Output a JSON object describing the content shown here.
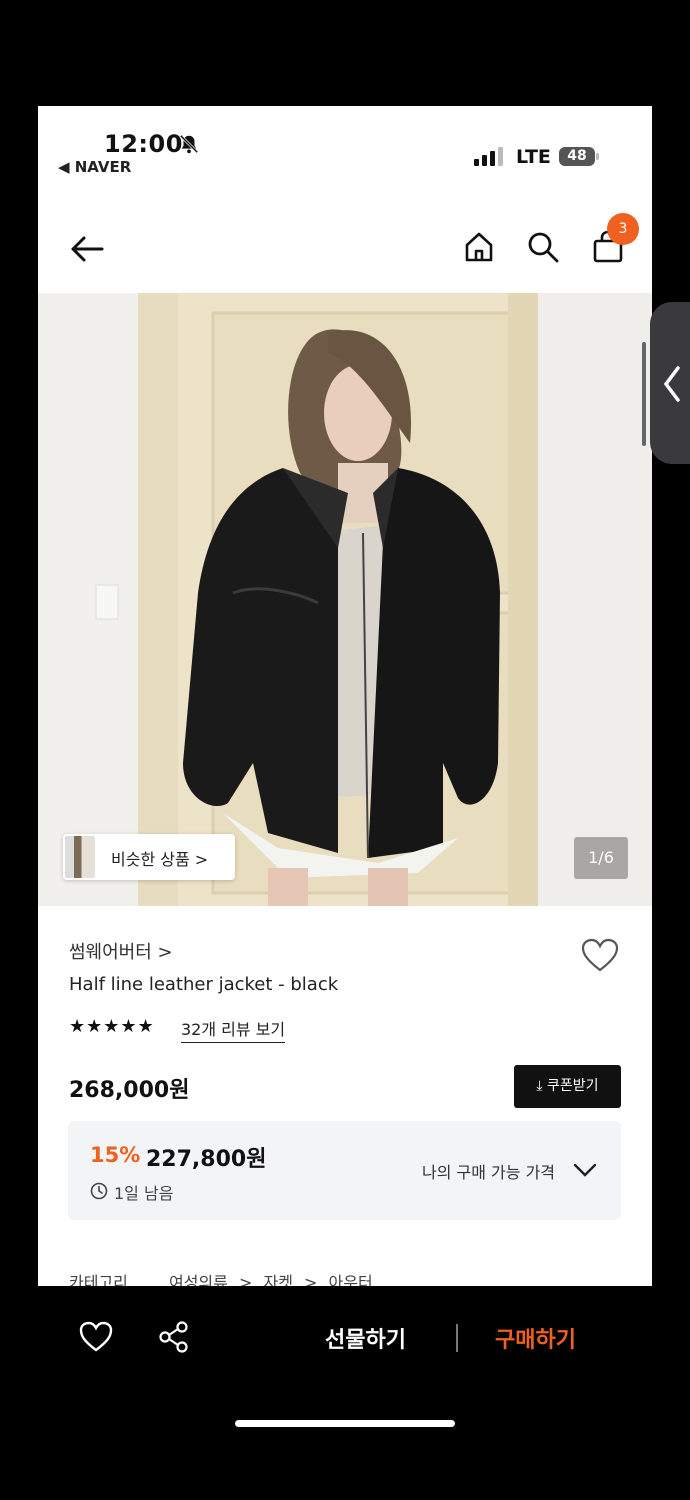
{
  "status": {
    "time": "12:00",
    "back_app": "◀ NAVER",
    "network": "LTE",
    "battery": "48"
  },
  "header": {
    "cart_count": "3"
  },
  "image": {
    "similar_label": "비슷한 상품 >",
    "counter": "1/6"
  },
  "product": {
    "brand": "썸웨어버터 >",
    "name": "Half line leather jacket - black",
    "stars": "★★★★★",
    "reviews_link": "32개 리뷰 보기",
    "price": "268,000원",
    "coupon_label": "⤓ 쿠폰받기",
    "discount_pct": "15%",
    "discount_price": "227,800원",
    "time_left": "1일 남음",
    "my_price_label": "나의 구매 가능 가격"
  },
  "category": {
    "label": "카테고리",
    "path": [
      "여성의류",
      ">",
      "자켓",
      ">",
      "아우터"
    ]
  },
  "bottom_bar": {
    "gift_label": "선물하기",
    "buy_label": "구매하기"
  },
  "colors": {
    "accent": "#f0601f",
    "badge": "#f0601f",
    "coupon_bg": "#111111"
  }
}
